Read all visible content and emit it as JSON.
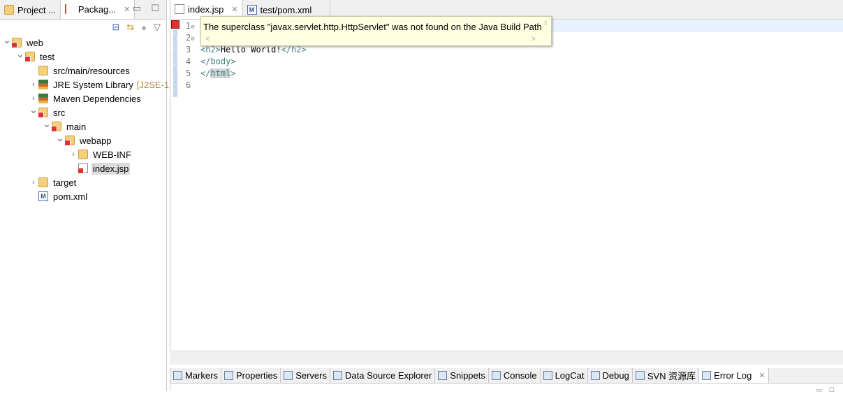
{
  "left_panel": {
    "tabs": [
      {
        "label": "Project ...",
        "icon": "project-explorer-icon"
      },
      {
        "label": "Packag...",
        "icon": "package-explorer-icon",
        "active": true
      }
    ],
    "tree": [
      {
        "label": "web",
        "depth": 0,
        "chevron": "expanded",
        "icon": "project",
        "error": true
      },
      {
        "label": "test",
        "depth": 1,
        "chevron": "expanded",
        "icon": "maven-project",
        "error": true
      },
      {
        "label": "src/main/resources",
        "depth": 2,
        "chevron": "none",
        "icon": "source-folder"
      },
      {
        "label": "JRE System Library",
        "decoration": "[J2SE-1.",
        "depth": 2,
        "chevron": "collapsed",
        "icon": "library"
      },
      {
        "label": "Maven Dependencies",
        "depth": 2,
        "chevron": "collapsed",
        "icon": "library"
      },
      {
        "label": "src",
        "depth": 2,
        "chevron": "expanded",
        "icon": "folder",
        "error": true
      },
      {
        "label": "main",
        "depth": 3,
        "chevron": "expanded",
        "icon": "folder",
        "error": true
      },
      {
        "label": "webapp",
        "depth": 4,
        "chevron": "expanded",
        "icon": "folder",
        "error": true
      },
      {
        "label": "WEB-INF",
        "depth": 5,
        "chevron": "collapsed",
        "icon": "folder"
      },
      {
        "label": "index.jsp",
        "depth": 5,
        "chevron": "none",
        "icon": "file",
        "error": true,
        "selected": true
      },
      {
        "label": "target",
        "depth": 2,
        "chevron": "collapsed",
        "icon": "folder"
      },
      {
        "label": "pom.xml",
        "depth": 2,
        "chevron": "none",
        "icon": "maven-file"
      }
    ]
  },
  "editor": {
    "tabs": [
      {
        "label": "index.jsp",
        "active": true
      },
      {
        "label": "test/pom.xml"
      }
    ],
    "line_numbers": [
      "1",
      "2",
      "3",
      "4",
      "5",
      "6"
    ],
    "fold_markers": [
      "⊖",
      "⊖"
    ],
    "lines": {
      "l3": {
        "t1": "<h2>",
        "t2": "Hello World!",
        "t3": "</h2>"
      },
      "l4": "</body>",
      "l5": {
        "t1": "</",
        "t2": "html",
        "t3": ">"
      }
    },
    "tooltip": "The superclass \"javax.servlet.http.HttpServlet\" was not found on the Java Build Path"
  },
  "bottom_panel": {
    "tabs": [
      {
        "label": "Markers"
      },
      {
        "label": "Properties"
      },
      {
        "label": "Servers"
      },
      {
        "label": "Data Source Explorer"
      },
      {
        "label": "Snippets"
      },
      {
        "label": "Console"
      },
      {
        "label": "LogCat"
      },
      {
        "label": "Debug"
      },
      {
        "label": "SVN 资源库"
      },
      {
        "label": "Error Log",
        "active": true
      }
    ]
  },
  "colors": {
    "error": "#dd3333",
    "current_line": "#e8f2fe",
    "tag": "#3f7f7f",
    "tooltip_bg": "#ffffe1"
  }
}
